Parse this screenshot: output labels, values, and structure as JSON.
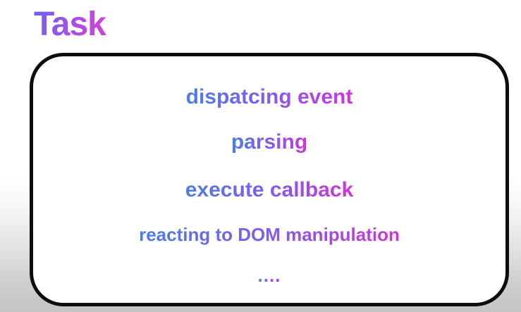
{
  "slide": {
    "title": "Task",
    "task_items": [
      "dispatcing event",
      "parsing",
      "execute callback",
      "reacting to DOM manipulation",
      "...."
    ]
  },
  "colors": {
    "gradient_start": "#4a7fe6",
    "gradient_mid": "#7a5ff0",
    "gradient_end": "#d233dc",
    "box_border": "#0d0d0d",
    "box_fill": "#ffffff"
  }
}
